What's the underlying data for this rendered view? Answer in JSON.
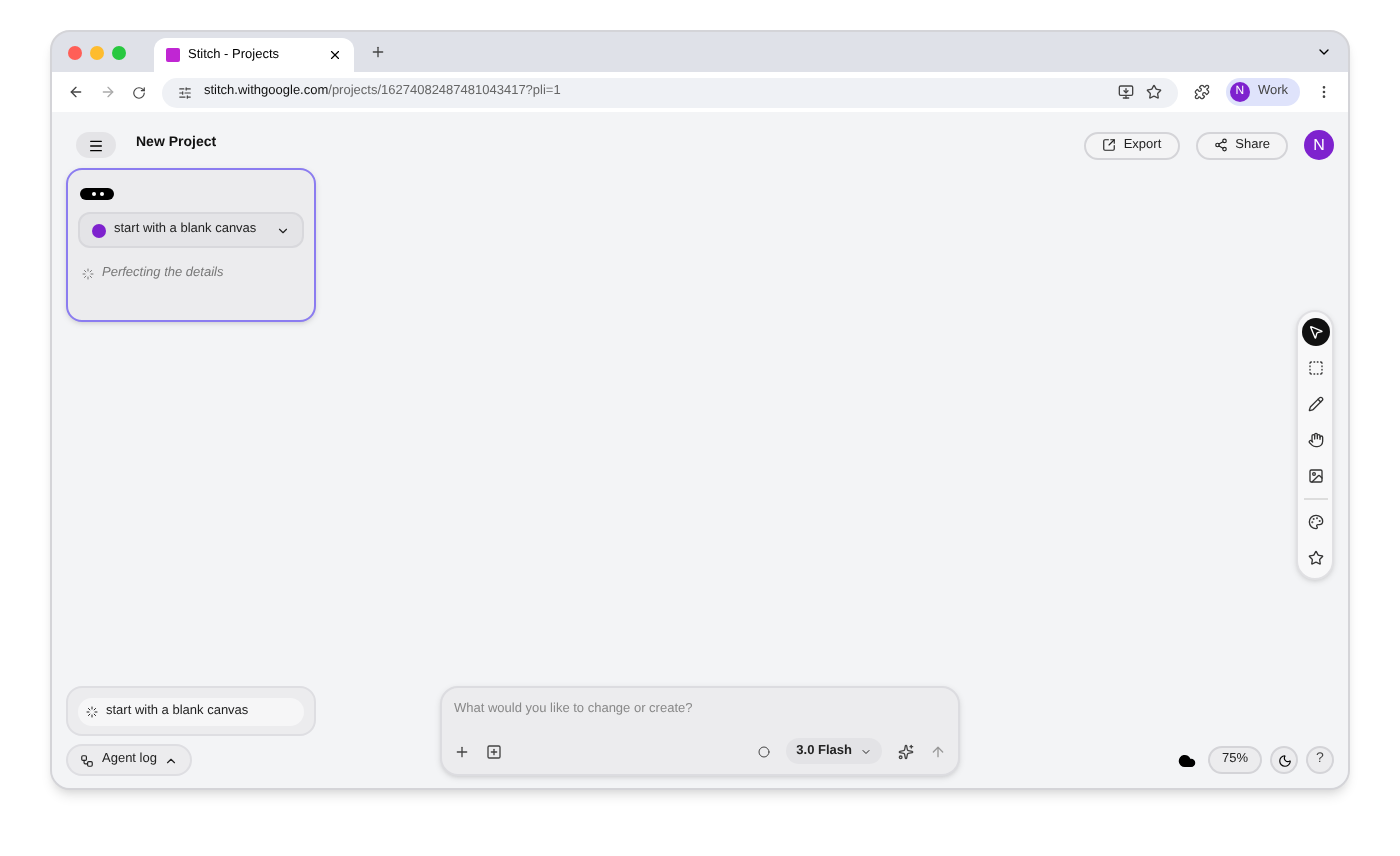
{
  "browser": {
    "tabs": [
      {
        "title": "Stitch - Projects",
        "selected": true
      }
    ],
    "url_host": "stitch.withgoogle.com",
    "url_path": "/projects/16274082487481043417?pli=1",
    "profile": {
      "avatar": "N",
      "label": "Work"
    }
  },
  "header": {
    "title": "New Project",
    "buttons": [
      {
        "kind": "export",
        "label": "Export"
      },
      {
        "kind": "share",
        "label": "Share"
      }
    ],
    "avatar": "N"
  },
  "card": {
    "dropdown": "start with a blank canvas",
    "status": "Perfecting the details"
  },
  "tool_groups": [
    [
      {
        "kind": "select",
        "selected": true
      },
      {
        "kind": "marquee",
        "selected": false
      },
      {
        "kind": "pencil",
        "selected": false
      },
      {
        "kind": "hand",
        "selected": false
      },
      {
        "kind": "image",
        "selected": false
      }
    ],
    [
      {
        "kind": "palette",
        "selected": false
      },
      {
        "kind": "star",
        "selected": false
      }
    ]
  ],
  "agent": {
    "task": "start with a blank canvas",
    "log_button": "Agent log"
  },
  "prompt": {
    "placeholder": "What would you like to change or create?",
    "model": "3.0 Flash"
  },
  "zoom": {
    "level_text": "75%",
    "help": "?"
  }
}
